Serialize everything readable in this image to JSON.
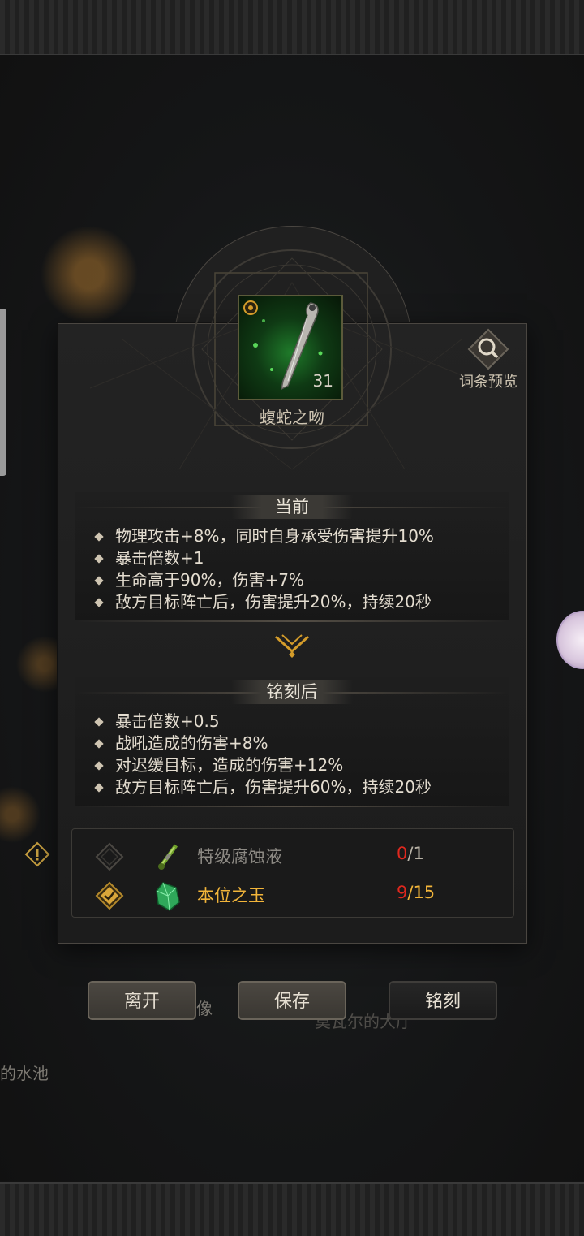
{
  "item": {
    "name": "蝮蛇之吻",
    "level": "31"
  },
  "preview": {
    "label": "词条预览"
  },
  "current": {
    "title": "当前",
    "stats": [
      "物理攻击+8%，同时自身承受伤害提升10%",
      "暴击倍数+1",
      "生命高于90%，伤害+7%",
      "敌方目标阵亡后，伤害提升20%，持续20秒"
    ]
  },
  "after": {
    "title": "铭刻后",
    "stats": [
      "暴击倍数+0.5",
      "战吼造成的伤害+8%",
      "对迟缓目标，造成的伤害+12%",
      "敌方目标阵亡后，伤害提升60%，持续20秒"
    ]
  },
  "materials": [
    {
      "name": "特级腐蚀液",
      "owned": "0",
      "required": "/1",
      "checked": false
    },
    {
      "name": "本位之玉",
      "owned": "9",
      "required": "/15",
      "checked": true
    }
  ],
  "buttons": {
    "leave": "离开",
    "save": "保存",
    "engrave": "铭刻"
  },
  "background": {
    "label_left": "的水池",
    "label_mid": "像",
    "label_right": "莫瓦尔的大厅"
  },
  "colors": {
    "gold": "#f2b53a",
    "red": "#e0281e",
    "muted": "#8d8a84"
  }
}
